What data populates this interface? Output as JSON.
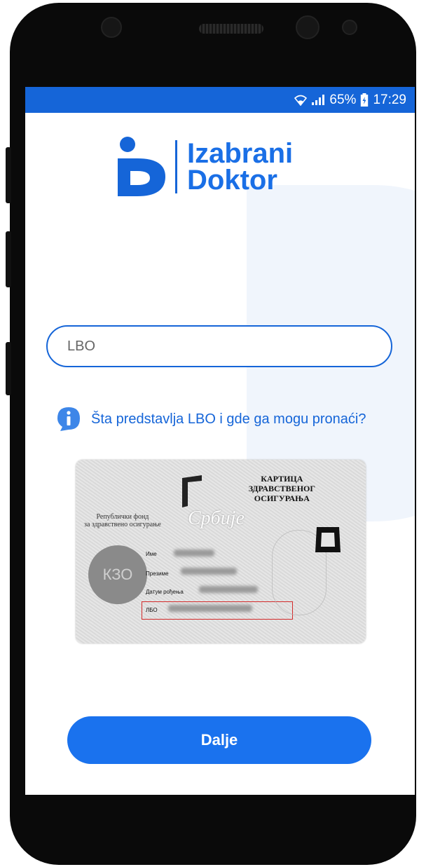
{
  "status_bar": {
    "battery_percent": "65%",
    "time": "17:29",
    "icons": [
      "wifi-icon",
      "signal-icon",
      "battery-icon"
    ]
  },
  "logo": {
    "line1": "Izabrani",
    "line2": "Doktor",
    "mark": "iD"
  },
  "form": {
    "lbo_placeholder": "LBO",
    "lbo_value": ""
  },
  "info": {
    "text": "Šta predstavlja LBO i gde ga mogu pronaći?",
    "icon": "info-icon"
  },
  "card": {
    "title_line1": "КАРТИЦА",
    "title_line2": "ЗДРАВСТВЕНОГ",
    "title_line3": "ОСИГУРАЊА",
    "fund_line1": "Републички фонд",
    "fund_line2": "за здравствено осигурање",
    "country": "Србије",
    "seal": "КЗО",
    "label_name": "Име",
    "label_surname": "Презиме",
    "label_dob": "Датум рођења",
    "label_lbo": "ЛБО"
  },
  "actions": {
    "next_label": "Dalje"
  },
  "colors": {
    "primary": "#1565d8",
    "button": "#1a72ee",
    "highlight": "#d32a2a"
  }
}
